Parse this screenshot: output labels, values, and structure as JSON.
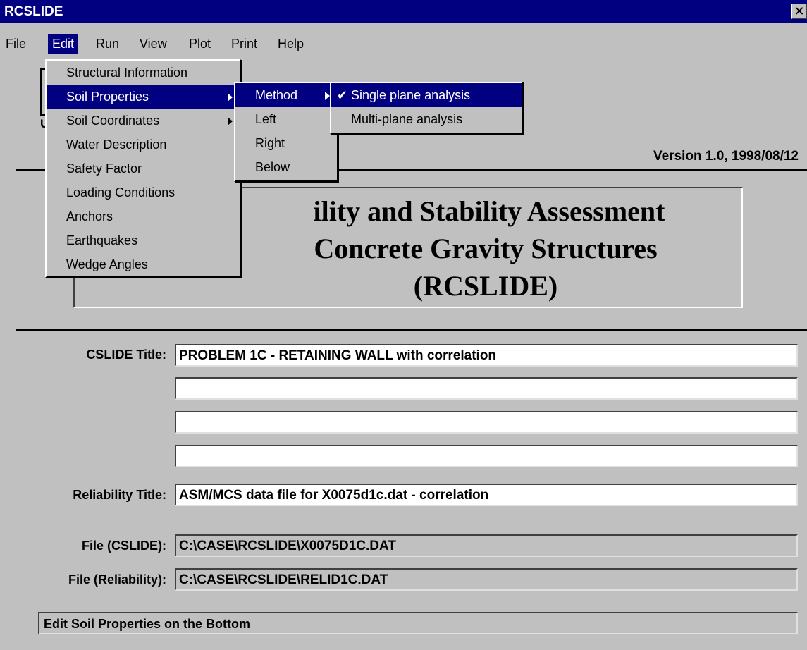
{
  "window": {
    "title": "RCSLIDE",
    "close_glyph": "✕"
  },
  "menubar": [
    {
      "label": "File"
    },
    {
      "label": "Edit"
    },
    {
      "label": "Run"
    },
    {
      "label": "View"
    },
    {
      "label": "Plot"
    },
    {
      "label": "Print"
    },
    {
      "label": "Help"
    }
  ],
  "edit_menu": [
    {
      "label": "Structural Information"
    },
    {
      "label": "Soil Properties"
    },
    {
      "label": "Soil Coordinates"
    },
    {
      "label": "Water Description"
    },
    {
      "label": "Safety Factor"
    },
    {
      "label": "Loading Conditions"
    },
    {
      "label": "Anchors"
    },
    {
      "label": "Earthquakes"
    },
    {
      "label": "Wedge Angles"
    }
  ],
  "soil_properties_menu": [
    {
      "label": "Method"
    },
    {
      "label": "Left"
    },
    {
      "label": "Right"
    },
    {
      "label": "Below"
    }
  ],
  "method_menu": [
    {
      "label": "Single plane analysis",
      "checked": true
    },
    {
      "label": "Multi-plane analysis",
      "checked": false
    }
  ],
  "check_glyph": "✔",
  "logo": {
    "letter": "U"
  },
  "version": "Version 1.0,  1998/08/12",
  "heading": {
    "line1": "ility and Stability Assessment",
    "line2": "Concrete Gravity Structures",
    "line3": "(RCSLIDE)"
  },
  "form": {
    "cslide_title_label": "CSLIDE Title:",
    "cslide_title_lines": [
      "PROBLEM 1C - RETAINING WALL with correlation",
      "",
      "",
      ""
    ],
    "reliability_title_label": "Reliability Title:",
    "reliability_title_value": "ASM/MCS data file for X0075d1c.dat - correlation",
    "file_cslide_label": "File (CSLIDE):",
    "file_cslide_value": "C:\\CASE\\RCSLIDE\\X0075D1C.DAT",
    "file_reliability_label": "File (Reliability):",
    "file_reliability_value": "C:\\CASE\\RCSLIDE\\RELID1C.DAT"
  },
  "status": "Edit Soil Properties on the Bottom",
  "colors": {
    "titlebar": "#000080",
    "face": "#c0c0c0",
    "highlight": "#000080"
  }
}
